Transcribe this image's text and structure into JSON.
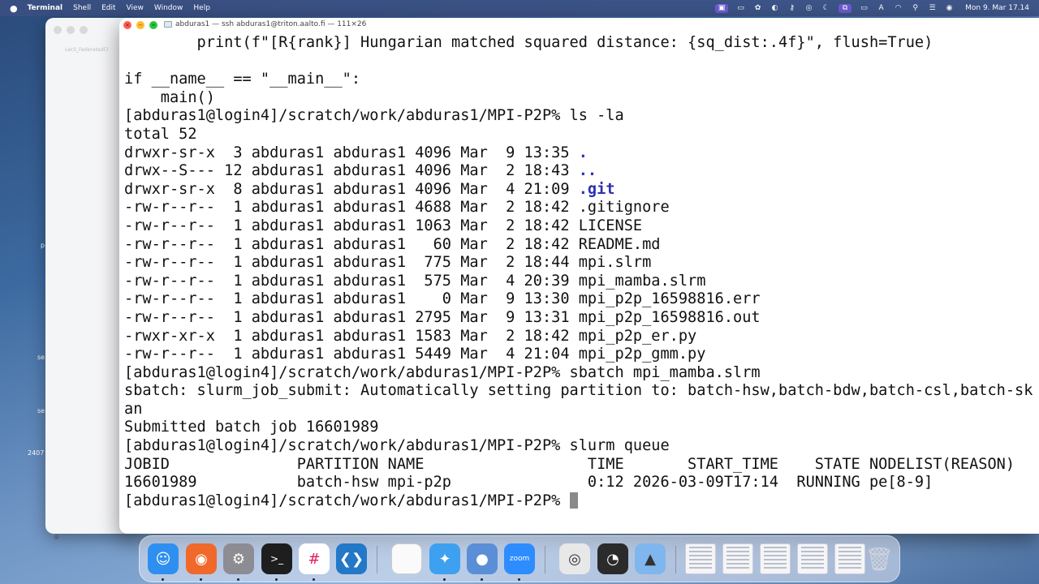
{
  "menubar": {
    "app": "Terminal",
    "items": [
      "Shell",
      "Edit",
      "View",
      "Window",
      "Help"
    ],
    "clock": "Mon 9. Mar  17.14"
  },
  "background_window": {
    "tab_label": "LecS_FederatedCl"
  },
  "desktop_labels": [
    "p",
    "se",
    "se",
    "2407"
  ],
  "terminal": {
    "title": "abduras1 — ssh abduras1@triton.aalto.fi — 111×26",
    "lines": [
      {
        "t": "        print(f\"[R{rank}] Hungarian matched squared distance: {sq_dist:.4f}\", flush=True)"
      },
      {
        "t": ""
      },
      {
        "t": "if __name__ == \"__main__\":"
      },
      {
        "t": "    main()"
      },
      {
        "t": "[abduras1@login4]/scratch/work/abduras1/MPI-P2P% ls -la"
      },
      {
        "t": "total 52"
      },
      {
        "t": "drwxr-sr-x  3 abduras1 abduras1 4096 Mar  9 13:35 ",
        "b": "."
      },
      {
        "t": "drwx--S--- 12 abduras1 abduras1 4096 Mar  2 18:43 ",
        "b": ".."
      },
      {
        "t": "drwxr-sr-x  8 abduras1 abduras1 4096 Mar  4 21:09 ",
        "b": ".git"
      },
      {
        "t": "-rw-r--r--  1 abduras1 abduras1 4688 Mar  2 18:42 .gitignore"
      },
      {
        "t": "-rw-r--r--  1 abduras1 abduras1 1063 Mar  2 18:42 LICENSE"
      },
      {
        "t": "-rw-r--r--  1 abduras1 abduras1   60 Mar  2 18:42 README.md"
      },
      {
        "t": "-rw-r--r--  1 abduras1 abduras1  775 Mar  2 18:44 mpi.slrm"
      },
      {
        "t": "-rw-r--r--  1 abduras1 abduras1  575 Mar  4 20:39 mpi_mamba.slrm"
      },
      {
        "t": "-rw-r--r--  1 abduras1 abduras1    0 Mar  9 13:30 mpi_p2p_16598816.err"
      },
      {
        "t": "-rw-r--r--  1 abduras1 abduras1 2795 Mar  9 13:31 mpi_p2p_16598816.out"
      },
      {
        "t": "-rwxr-xr-x  1 abduras1 abduras1 1583 Mar  2 18:42 mpi_p2p_er.py"
      },
      {
        "t": "-rw-r--r--  1 abduras1 abduras1 5449 Mar  4 21:04 mpi_p2p_gmm.py"
      },
      {
        "t": "[abduras1@login4]/scratch/work/abduras1/MPI-P2P% sbatch mpi_mamba.slrm"
      },
      {
        "t": "sbatch: slurm_job_submit: Automatically setting partition to: batch-hsw,batch-bdw,batch-csl,batch-sk"
      },
      {
        "t": "an"
      },
      {
        "t": "Submitted batch job 16601989"
      },
      {
        "t": "[abduras1@login4]/scratch/work/abduras1/MPI-P2P% slurm queue"
      },
      {
        "t": "JOBID              PARTITION NAME                  TIME       START_TIME    STATE NODELIST(REASON)"
      },
      {
        "t": "16601989           batch-hsw mpi-p2p               0:12 2026-03-09T17:14  RUNNING pe[8-9]"
      },
      {
        "t": "[abduras1@login4]/scratch/work/abduras1/MPI-P2P% ",
        "cursor": true
      }
    ]
  },
  "dock": {
    "items": [
      {
        "name": "finder-icon",
        "glyph": "☺",
        "color": "#2f8ff0",
        "running": true
      },
      {
        "name": "firefox-icon",
        "glyph": "◉",
        "color": "#f0682a",
        "running": true
      },
      {
        "name": "system-settings-icon",
        "glyph": "⚙",
        "color": "#8c8c92",
        "running": true
      },
      {
        "name": "terminal-icon",
        "glyph": ">_",
        "color": "#1e1e1e",
        "running": true
      },
      {
        "name": "slack-icon",
        "glyph": "#",
        "color": "#ffffff",
        "running": true
      },
      {
        "name": "vscode-icon",
        "glyph": "❮❯",
        "color": "#2378c8",
        "running": false
      },
      {
        "name": "notes-icon",
        "glyph": "",
        "color": "#fafafa",
        "running": false
      },
      {
        "name": "safari-icon",
        "glyph": "✦",
        "color": "#3ea0f0",
        "running": true
      },
      {
        "name": "app-icon",
        "glyph": "●",
        "color": "#5a8fd8",
        "running": true
      },
      {
        "name": "zoom-icon",
        "glyph": "zoom",
        "color": "#2d8cff",
        "running": true
      },
      {
        "name": "screenshot-icon",
        "glyph": "◎",
        "color": "#e8e8e8",
        "running": false
      },
      {
        "name": "activity-monitor-icon",
        "glyph": "◔",
        "color": "#2b2b2b",
        "running": false
      },
      {
        "name": "applications-folder-icon",
        "glyph": "▲",
        "color": "#7fb6ee",
        "running": false
      }
    ]
  }
}
